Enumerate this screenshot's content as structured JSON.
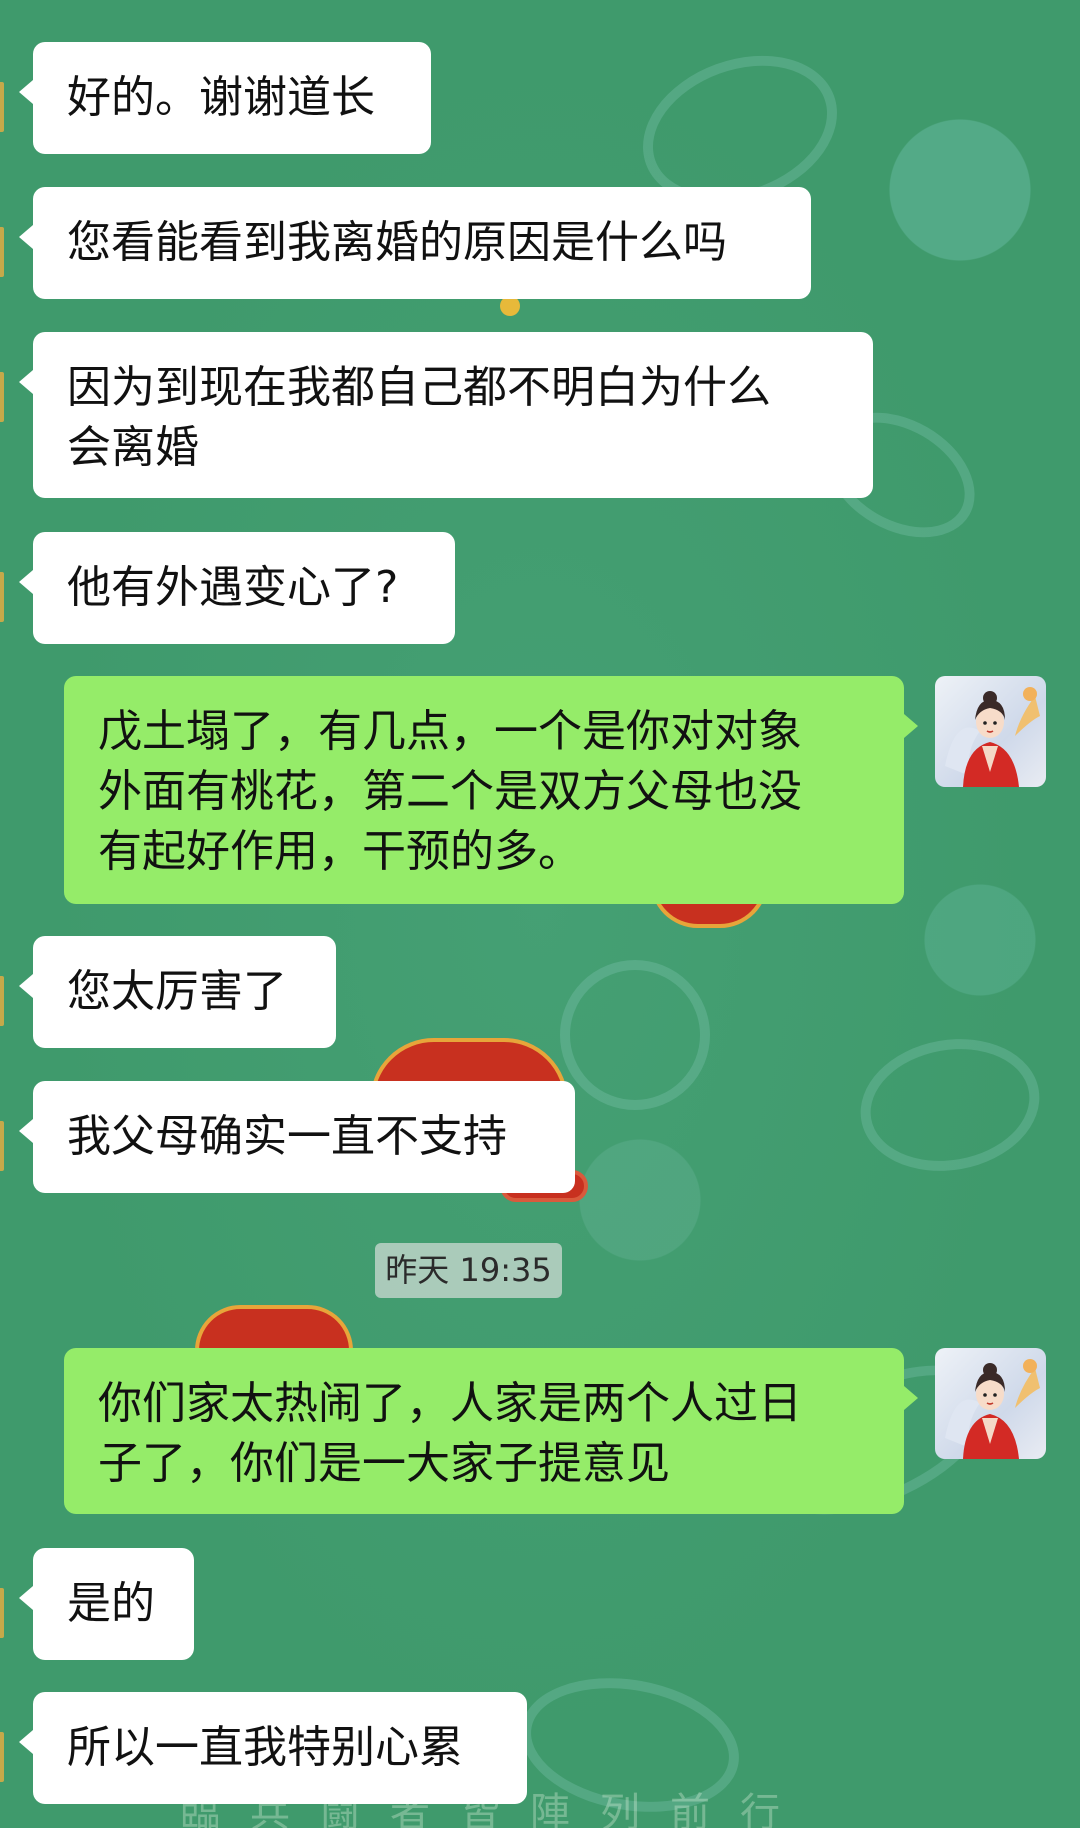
{
  "chat": {
    "messages": [
      {
        "side": "in",
        "text": "好的。谢谢道长"
      },
      {
        "side": "in",
        "text": "您看能看到我离婚的原因是什么吗"
      },
      {
        "side": "in",
        "text": "因为到现在我都自己都不明白为什么\n会离婚"
      },
      {
        "side": "in",
        "text": "他有外遇变心了?"
      },
      {
        "side": "out",
        "text": "戊土塌了，有几点，一个是你对对象\n外面有桃花，第二个是双方父母也没\n有起好作用，干预的多。"
      },
      {
        "side": "in",
        "text": "您太厉害了"
      },
      {
        "side": "in",
        "text": "我父母确实一直不支持"
      },
      {
        "side": "out",
        "text": "你们家太热闹了，人家是两个人过日\n子了，你们是一大家子提意见"
      },
      {
        "side": "in",
        "text": "是的"
      },
      {
        "side": "in",
        "text": "所以一直我特别心累"
      }
    ],
    "timestamp": "昨天 19:35"
  },
  "colors": {
    "background": "#3f9a6c",
    "incoming_bubble": "#ffffff",
    "outgoing_bubble": "#95ec69"
  },
  "icons": {
    "avatar": "avatar-woman-red-hanfu"
  }
}
